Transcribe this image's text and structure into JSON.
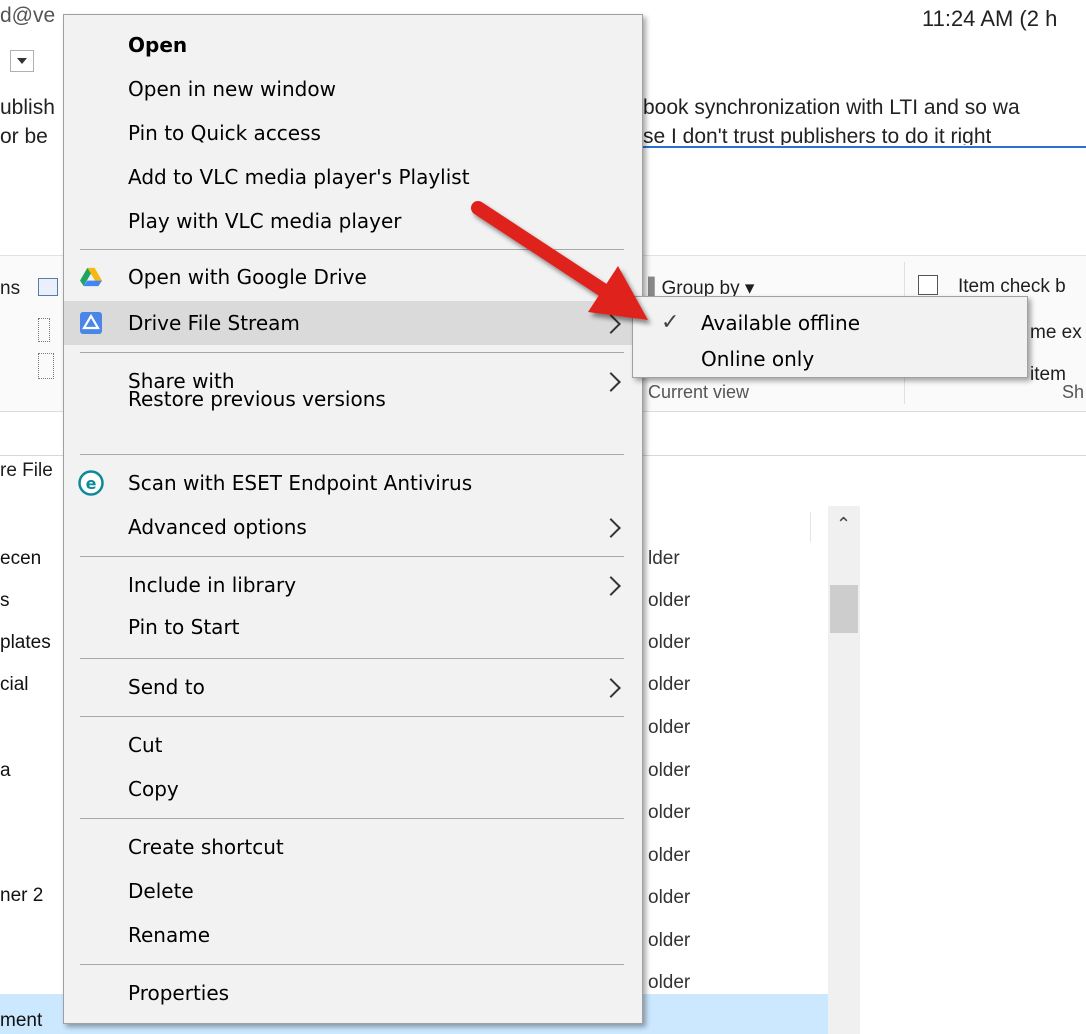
{
  "email": {
    "from_fragment": "d@ve",
    "time": "11:24 AM (2 h",
    "body_line1_left": "ublish",
    "body_line1_right": "book synchronization with LTI and so wa",
    "body_line2_left": "or be",
    "body_line2_right": "se I don't trust publishers to do it right"
  },
  "ribbon": {
    "left_text_1": "ns",
    "group_by": "Group by",
    "item_check": "Item check b",
    "name_ext": "me ex",
    "hidden_items": "item",
    "current_view": "Current view",
    "show_fragment": "Sh"
  },
  "address_fragment": "re File",
  "file_list": {
    "names": [
      "ecen",
      "s",
      "plates",
      "cial",
      "a",
      "ner 2",
      "ment"
    ],
    "type_labels": [
      "lder",
      "older",
      "older",
      "older",
      "older",
      "older",
      "older",
      "older",
      "older",
      "older",
      "older"
    ]
  },
  "context_menu": {
    "items": [
      {
        "label": "Open"
      },
      {
        "label": "Open in new window"
      },
      {
        "label": "Pin to Quick access"
      },
      {
        "label": "Add to VLC media player's Playlist"
      },
      {
        "label": "Play with VLC media player"
      },
      {
        "label": "Open with Google Drive"
      },
      {
        "label": "Drive File Stream"
      },
      {
        "label": "Share with"
      },
      {
        "label": "Restore previous versions"
      },
      {
        "label": "Scan with ESET Endpoint Antivirus"
      },
      {
        "label": "Advanced options"
      },
      {
        "label": "Include in library"
      },
      {
        "label": "Pin to Start"
      },
      {
        "label": "Send to"
      },
      {
        "label": "Cut"
      },
      {
        "label": "Copy"
      },
      {
        "label": "Create shortcut"
      },
      {
        "label": "Delete"
      },
      {
        "label": "Rename"
      },
      {
        "label": "Properties"
      }
    ]
  },
  "submenu": {
    "items": [
      {
        "label": "Available offline",
        "checked": true
      },
      {
        "label": "Online only",
        "checked": false
      }
    ]
  },
  "icons": [
    "google-drive-icon",
    "drive-file-stream-icon",
    "eset-icon",
    "checkmark-icon",
    "red-arrow-annotation"
  ],
  "colors": {
    "menu_bg": "#f2f2f2",
    "menu_highlight": "#dadada",
    "arrow_red": "#e0201b",
    "selection_blue": "#cce8ff"
  }
}
